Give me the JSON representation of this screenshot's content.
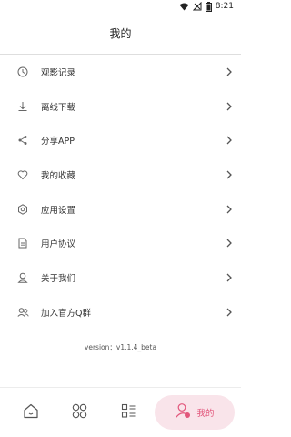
{
  "status_bar": {
    "time": "8:21"
  },
  "header": {
    "title": "我的"
  },
  "menu": {
    "items": [
      {
        "label": "观影记录",
        "icon": "history-clock-icon"
      },
      {
        "label": "离线下载",
        "icon": "download-icon"
      },
      {
        "label": "分享APP",
        "icon": "share-icon"
      },
      {
        "label": "我的收藏",
        "icon": "heart-icon"
      },
      {
        "label": "应用设置",
        "icon": "settings-icon"
      },
      {
        "label": "用户协议",
        "icon": "document-icon"
      },
      {
        "label": "关于我们",
        "icon": "user-icon"
      },
      {
        "label": "加入官方Q群",
        "icon": "group-icon"
      }
    ]
  },
  "version": "version：v1.1.4_beta",
  "tabbar": {
    "tabs": [
      {
        "icon": "home-icon"
      },
      {
        "icon": "grid-icon"
      },
      {
        "icon": "list-icon"
      },
      {
        "icon": "profile-icon",
        "label": "我的",
        "active": true
      }
    ]
  },
  "colors": {
    "accent": "#e2567b",
    "active_tab_bg": "#f9e4ea",
    "icon_gray": "#666666"
  }
}
